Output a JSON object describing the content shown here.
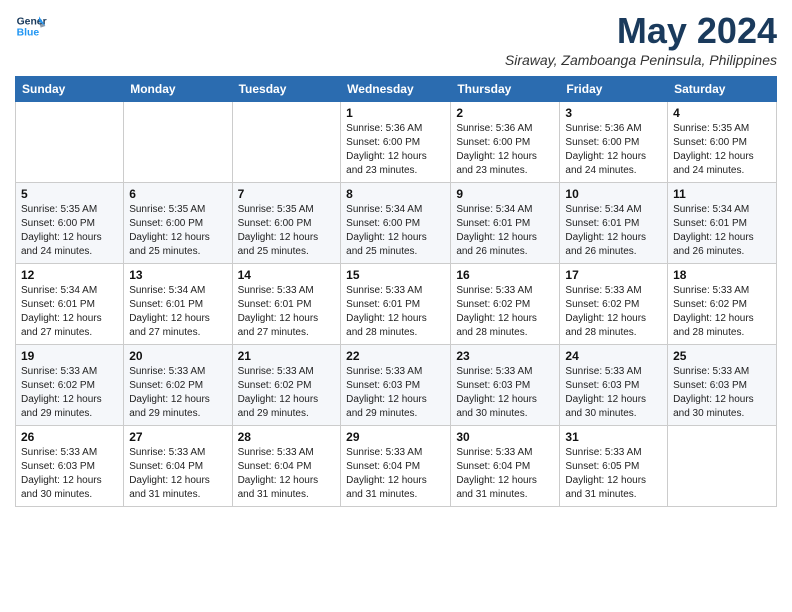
{
  "logo": {
    "line1": "General",
    "line2": "Blue"
  },
  "title": "May 2024",
  "location": "Siraway, Zamboanga Peninsula, Philippines",
  "days_header": [
    "Sunday",
    "Monday",
    "Tuesday",
    "Wednesday",
    "Thursday",
    "Friday",
    "Saturday"
  ],
  "weeks": [
    [
      {
        "day": "",
        "info": ""
      },
      {
        "day": "",
        "info": ""
      },
      {
        "day": "",
        "info": ""
      },
      {
        "day": "1",
        "info": "Sunrise: 5:36 AM\nSunset: 6:00 PM\nDaylight: 12 hours\nand 23 minutes."
      },
      {
        "day": "2",
        "info": "Sunrise: 5:36 AM\nSunset: 6:00 PM\nDaylight: 12 hours\nand 23 minutes."
      },
      {
        "day": "3",
        "info": "Sunrise: 5:36 AM\nSunset: 6:00 PM\nDaylight: 12 hours\nand 24 minutes."
      },
      {
        "day": "4",
        "info": "Sunrise: 5:35 AM\nSunset: 6:00 PM\nDaylight: 12 hours\nand 24 minutes."
      }
    ],
    [
      {
        "day": "5",
        "info": "Sunrise: 5:35 AM\nSunset: 6:00 PM\nDaylight: 12 hours\nand 24 minutes."
      },
      {
        "day": "6",
        "info": "Sunrise: 5:35 AM\nSunset: 6:00 PM\nDaylight: 12 hours\nand 25 minutes."
      },
      {
        "day": "7",
        "info": "Sunrise: 5:35 AM\nSunset: 6:00 PM\nDaylight: 12 hours\nand 25 minutes."
      },
      {
        "day": "8",
        "info": "Sunrise: 5:34 AM\nSunset: 6:00 PM\nDaylight: 12 hours\nand 25 minutes."
      },
      {
        "day": "9",
        "info": "Sunrise: 5:34 AM\nSunset: 6:01 PM\nDaylight: 12 hours\nand 26 minutes."
      },
      {
        "day": "10",
        "info": "Sunrise: 5:34 AM\nSunset: 6:01 PM\nDaylight: 12 hours\nand 26 minutes."
      },
      {
        "day": "11",
        "info": "Sunrise: 5:34 AM\nSunset: 6:01 PM\nDaylight: 12 hours\nand 26 minutes."
      }
    ],
    [
      {
        "day": "12",
        "info": "Sunrise: 5:34 AM\nSunset: 6:01 PM\nDaylight: 12 hours\nand 27 minutes."
      },
      {
        "day": "13",
        "info": "Sunrise: 5:34 AM\nSunset: 6:01 PM\nDaylight: 12 hours\nand 27 minutes."
      },
      {
        "day": "14",
        "info": "Sunrise: 5:33 AM\nSunset: 6:01 PM\nDaylight: 12 hours\nand 27 minutes."
      },
      {
        "day": "15",
        "info": "Sunrise: 5:33 AM\nSunset: 6:01 PM\nDaylight: 12 hours\nand 28 minutes."
      },
      {
        "day": "16",
        "info": "Sunrise: 5:33 AM\nSunset: 6:02 PM\nDaylight: 12 hours\nand 28 minutes."
      },
      {
        "day": "17",
        "info": "Sunrise: 5:33 AM\nSunset: 6:02 PM\nDaylight: 12 hours\nand 28 minutes."
      },
      {
        "day": "18",
        "info": "Sunrise: 5:33 AM\nSunset: 6:02 PM\nDaylight: 12 hours\nand 28 minutes."
      }
    ],
    [
      {
        "day": "19",
        "info": "Sunrise: 5:33 AM\nSunset: 6:02 PM\nDaylight: 12 hours\nand 29 minutes."
      },
      {
        "day": "20",
        "info": "Sunrise: 5:33 AM\nSunset: 6:02 PM\nDaylight: 12 hours\nand 29 minutes."
      },
      {
        "day": "21",
        "info": "Sunrise: 5:33 AM\nSunset: 6:02 PM\nDaylight: 12 hours\nand 29 minutes."
      },
      {
        "day": "22",
        "info": "Sunrise: 5:33 AM\nSunset: 6:03 PM\nDaylight: 12 hours\nand 29 minutes."
      },
      {
        "day": "23",
        "info": "Sunrise: 5:33 AM\nSunset: 6:03 PM\nDaylight: 12 hours\nand 30 minutes."
      },
      {
        "day": "24",
        "info": "Sunrise: 5:33 AM\nSunset: 6:03 PM\nDaylight: 12 hours\nand 30 minutes."
      },
      {
        "day": "25",
        "info": "Sunrise: 5:33 AM\nSunset: 6:03 PM\nDaylight: 12 hours\nand 30 minutes."
      }
    ],
    [
      {
        "day": "26",
        "info": "Sunrise: 5:33 AM\nSunset: 6:03 PM\nDaylight: 12 hours\nand 30 minutes."
      },
      {
        "day": "27",
        "info": "Sunrise: 5:33 AM\nSunset: 6:04 PM\nDaylight: 12 hours\nand 31 minutes."
      },
      {
        "day": "28",
        "info": "Sunrise: 5:33 AM\nSunset: 6:04 PM\nDaylight: 12 hours\nand 31 minutes."
      },
      {
        "day": "29",
        "info": "Sunrise: 5:33 AM\nSunset: 6:04 PM\nDaylight: 12 hours\nand 31 minutes."
      },
      {
        "day": "30",
        "info": "Sunrise: 5:33 AM\nSunset: 6:04 PM\nDaylight: 12 hours\nand 31 minutes."
      },
      {
        "day": "31",
        "info": "Sunrise: 5:33 AM\nSunset: 6:05 PM\nDaylight: 12 hours\nand 31 minutes."
      },
      {
        "day": "",
        "info": ""
      }
    ]
  ]
}
